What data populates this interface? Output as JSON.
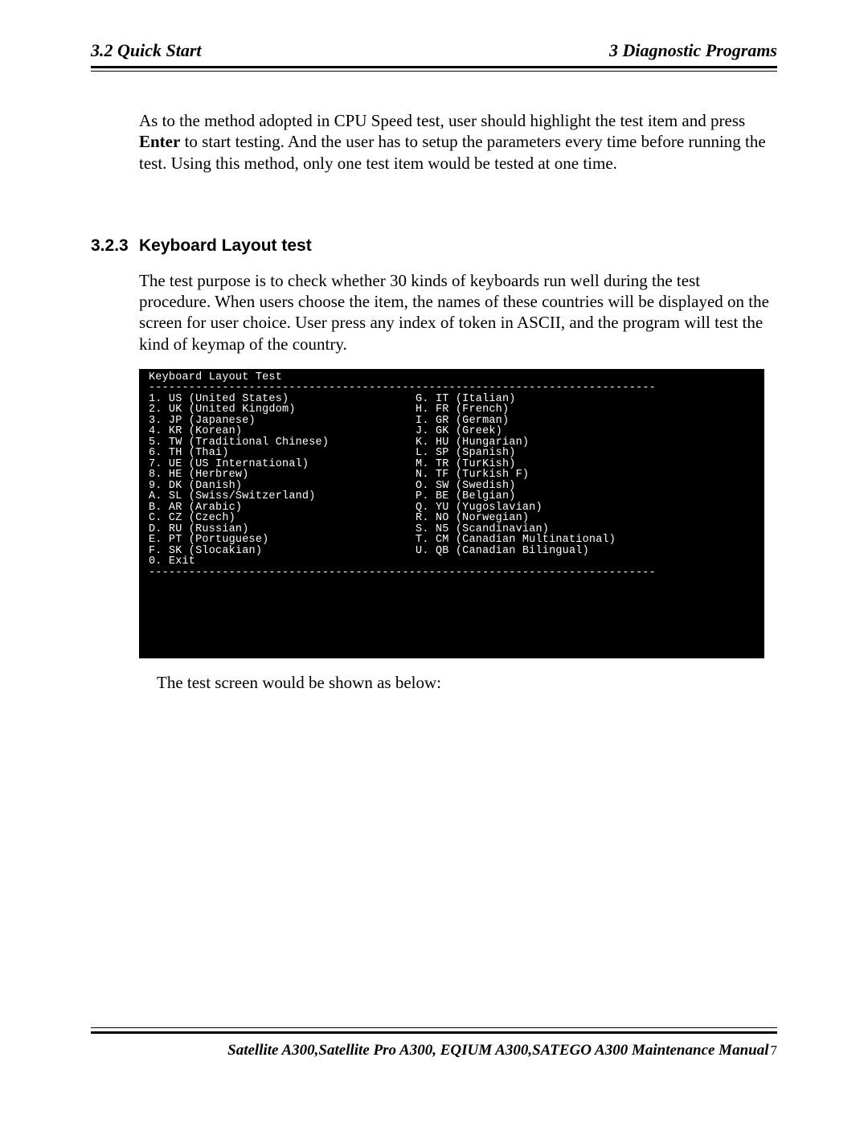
{
  "header": {
    "left": "3.2 Quick Start",
    "right": "3  Diagnostic Programs"
  },
  "intro": {
    "p1_a": "As to the method adopted in CPU Speed test, user should highlight the test item and press ",
    "p1_b": "Enter",
    "p1_c": " to start testing. And the user has to setup the parameters every time before running the test. Using this method, only one test item would be tested at one time."
  },
  "section": {
    "num": "3.2.3",
    "title": "Keyboard Layout test",
    "para": "The test purpose is to check whether 30 kinds of keyboards run well during the test procedure. When users choose the item, the names of these countries will be displayed on the screen for user choice. User press any index of token in ASCII, and the program will test the kind of keymap of the country."
  },
  "terminal": {
    "title": "Keyboard Layout Test",
    "rule": "----------------------------------------------------------------------------",
    "left": [
      "1. US (United States)",
      "2. UK (United Kingdom)",
      "3. JP (Japanese)",
      "4. KR (Korean)",
      "5. TW (Traditional Chinese)",
      "6. TH (Thai)",
      "7. UE (US International)",
      "8. HE (Herbrew)",
      "9. DK (Danish)",
      "A. SL (Swiss/Switzerland)",
      "B. AR (Arabic)",
      "C. CZ (Czech)",
      "D. RU (Russian)",
      "E. PT (Portuguese)",
      "F. SK (Slocakian)"
    ],
    "right": [
      "G. IT (Italian)",
      "H. FR (French)",
      "I. GR (German)",
      "J. GK (Greek)",
      "K. HU (Hungarian)",
      "L. SP (Spanish)",
      "M. TR (TurKish)",
      "N. TF (Turkish F)",
      "O. SW (Swedish)",
      "P. BE (Belgian)",
      "Q. YU (Yugoslavian)",
      "R. NO (Norwegian)",
      "S. N5 (Scandinavian)",
      "T. CM (Canadian Multinational)",
      "U. QB (Canadian Bilingual)"
    ],
    "exit": "0. Exit"
  },
  "after": "The test screen would be shown as below:",
  "footer": {
    "text": "Satellite A300,Satellite Pro A300, EQIUM A300,SATEGO A300 Maintenance Manual",
    "page": "7"
  }
}
